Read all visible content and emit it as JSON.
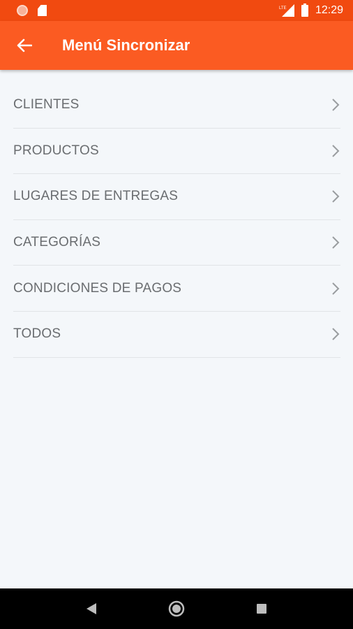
{
  "status_bar": {
    "time": "12:29",
    "network_label": "LTE",
    "icons": [
      "notification-dot-icon",
      "sd-card-icon",
      "lte-signal-icon",
      "battery-icon"
    ]
  },
  "app_bar": {
    "back_icon": "arrow-back-icon",
    "title": "Menú Sincronizar",
    "color": "#fb5b22"
  },
  "menu": {
    "items": [
      {
        "label": "CLIENTES"
      },
      {
        "label": "PRODUCTOS"
      },
      {
        "label": "LUGARES DE ENTREGAS"
      },
      {
        "label": "CATEGORÍAS"
      },
      {
        "label": "CONDICIONES DE PAGOS"
      },
      {
        "label": "TODOS"
      }
    ],
    "chevron_icon": "chevron-right-icon"
  },
  "nav_bar": {
    "icons": [
      "back-triangle-icon",
      "home-circle-icon",
      "recents-square-icon"
    ]
  }
}
